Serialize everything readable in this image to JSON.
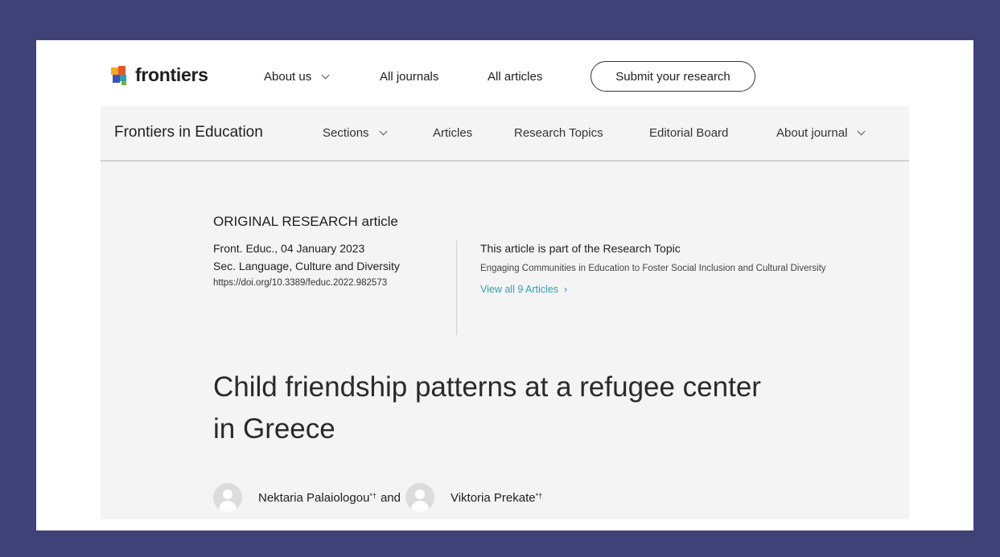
{
  "topnav": {
    "brand": "frontiers",
    "items": [
      {
        "label": "About us",
        "dropdown": true
      },
      {
        "label": "All journals",
        "dropdown": false
      },
      {
        "label": "All articles",
        "dropdown": false
      }
    ],
    "submit_label": "Submit your research"
  },
  "journal_nav": {
    "title": "Frontiers in Education",
    "items": [
      {
        "label": "Sections",
        "dropdown": true
      },
      {
        "label": "Articles",
        "dropdown": false
      },
      {
        "label": "Research Topics",
        "dropdown": false
      },
      {
        "label": "Editorial Board",
        "dropdown": false
      },
      {
        "label": "About journal",
        "dropdown": true
      }
    ]
  },
  "article": {
    "type": "ORIGINAL RESEARCH article",
    "citation": "Front. Educ., 04 January 2023",
    "section": "Sec. Language, Culture and Diversity",
    "doi": "https://doi.org/10.3389/feduc.2022.982573",
    "topic_heading": "This article is part of the Research Topic",
    "topic_name": "Engaging Communities in Education to Foster Social Inclusion and Cultural Diversity",
    "topic_link": "View all 9 Articles",
    "title": "Child friendship patterns at a refugee center in Greece",
    "authors": [
      {
        "name": "Nektaria Palaiologou",
        "marks": "*†"
      },
      {
        "name": "Viktoria Prekate",
        "marks": "*†"
      }
    ],
    "author_joiner": "and"
  },
  "colors": {
    "background": "#3f4177",
    "link": "#2aa1b0",
    "logo_palette": [
      "#f5a623",
      "#e4572e",
      "#3f51b5",
      "#2aa1b0",
      "#76b041"
    ]
  },
  "icons": [
    "frontiers-logo-icon",
    "chevron-down-icon",
    "chevron-right-icon",
    "avatar-placeholder-icon"
  ]
}
